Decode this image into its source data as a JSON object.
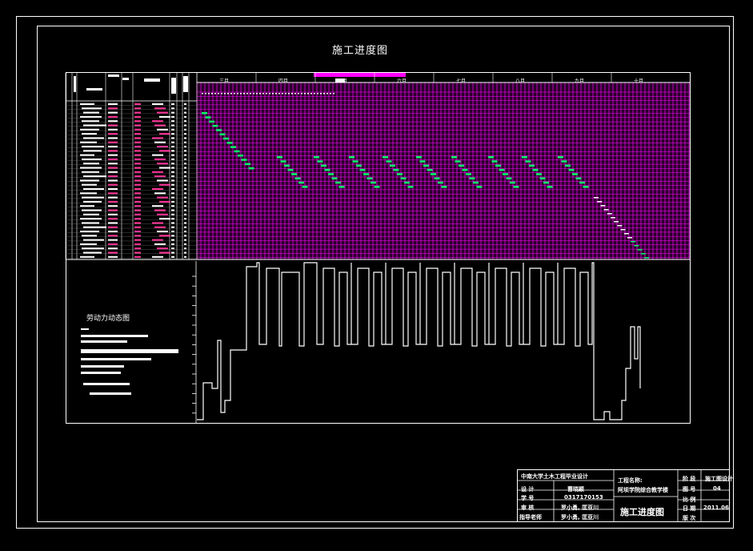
{
  "drawing": {
    "title": "施工进度图",
    "labor_chart_title": "劳动力动态图"
  },
  "schedule": {
    "month_labels": [
      "三月",
      "四月",
      "五月",
      "六月",
      "七月",
      "八月",
      "九月",
      "十月"
    ],
    "highlight_color": "#ff00ff",
    "bar_color": "#00ff66"
  },
  "title_block": {
    "institution": "中南大学土木工程毕业设计",
    "design_label": "设 计",
    "design_value": "曹晓颖",
    "student_id_label": "学 号",
    "student_id_value": "0317170153",
    "review_label": "审 核",
    "review_value": "罗小勇, 匡亚川",
    "advisor_label": "指导老师",
    "advisor_value": "罗小勇, 匡亚川",
    "project_label": "工程名称:",
    "project_value": "阿坝学院综合教学楼",
    "sheet_title": "施工进度图",
    "stage_label": "阶 段",
    "stage_value": "施工图设计",
    "number_label": "图 号",
    "number_value": "04",
    "ratio_label": "比 例",
    "date_label": "日 期",
    "date_value": "2011.06",
    "version_label": "版 次"
  },
  "colors": {
    "grid": "#ff00ff",
    "lines": "#ffffff",
    "background": "#000000"
  }
}
